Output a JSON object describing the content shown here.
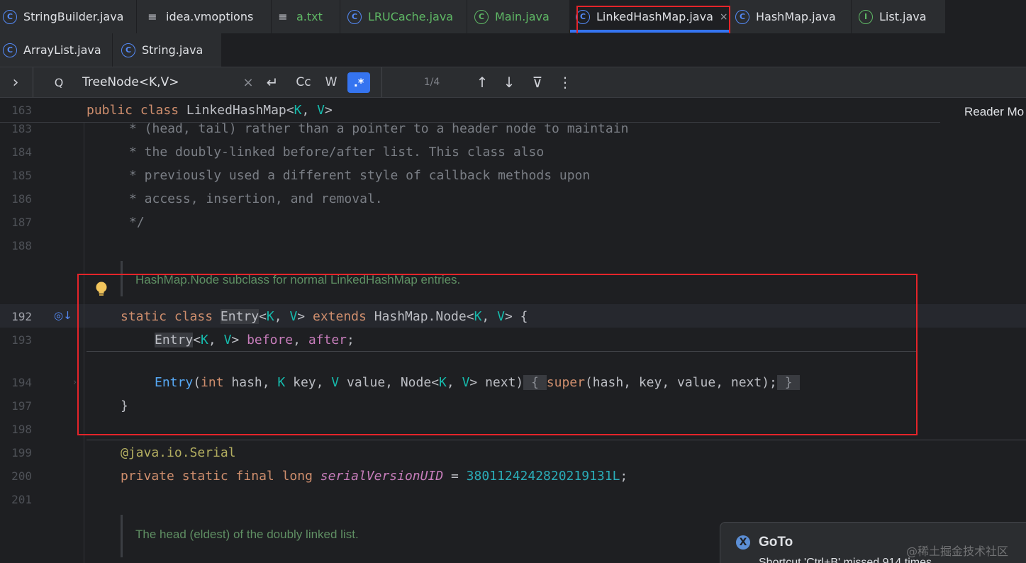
{
  "tabs_row1": [
    {
      "label": "StringBuilder.java",
      "icon": "class-icon",
      "glyph": "C"
    },
    {
      "label": "idea.vmoptions",
      "icon": "settings-file-icon",
      "glyph": "≡"
    },
    {
      "label": "a.txt",
      "icon": "text-file-icon",
      "glyph": "≡"
    },
    {
      "label": "LRUCache.java",
      "icon": "class-icon",
      "glyph": "C"
    },
    {
      "label": "Main.java",
      "icon": "main-class-icon",
      "glyph": "C"
    },
    {
      "label": "LinkedHashMap.java",
      "icon": "class-icon",
      "glyph": "C",
      "active": true,
      "close": "×"
    },
    {
      "label": "HashMap.java",
      "icon": "class-icon",
      "glyph": "C"
    },
    {
      "label": "List.java",
      "icon": "interface-icon",
      "glyph": "I"
    }
  ],
  "tabs_row2": [
    {
      "label": "ArrayList.java",
      "icon": "class-icon",
      "glyph": "C"
    },
    {
      "label": "String.java",
      "icon": "class-icon",
      "glyph": "C"
    }
  ],
  "find": {
    "expand": "›",
    "search_icon": "Q",
    "query": "TreeNode<K,V>",
    "clear": "×",
    "newline": "↵",
    "match_case": "Cc",
    "words": "W",
    "regex": ".*",
    "count": "1/4",
    "prev": "↑",
    "next": "↓",
    "filter": "⊽",
    "more": "⋮"
  },
  "editor": {
    "reader_mode": "Reader Mo",
    "sticky_line": "163",
    "gutter": [
      "183",
      "184",
      "185",
      "186",
      "187",
      "188",
      "192",
      "193",
      "194",
      "197",
      "198",
      "199",
      "200",
      "201"
    ],
    "comment_lines": [
      "* (head, tail) rather than a pointer to a header node to maintain",
      "* the doubly-linked before/after list. This class also",
      "* previously used a different style of callback methods upon",
      "* access, insertion, and removal.",
      "*/"
    ],
    "doc_entry": "HashMap.Node subclass for normal LinkedHashMap entries.",
    "doc_head": "The head (eldest) of the doubly linked list.",
    "serial_value": "3801124242820219131L"
  },
  "notification": {
    "title": "GoTo",
    "body": "Shortcut 'Ctrl+B' missed 914 times",
    "icon": "X"
  },
  "watermark": "@稀土掘金技术社区",
  "colors": {
    "accent": "#3574f0",
    "highlight_box": "#e5242a"
  }
}
